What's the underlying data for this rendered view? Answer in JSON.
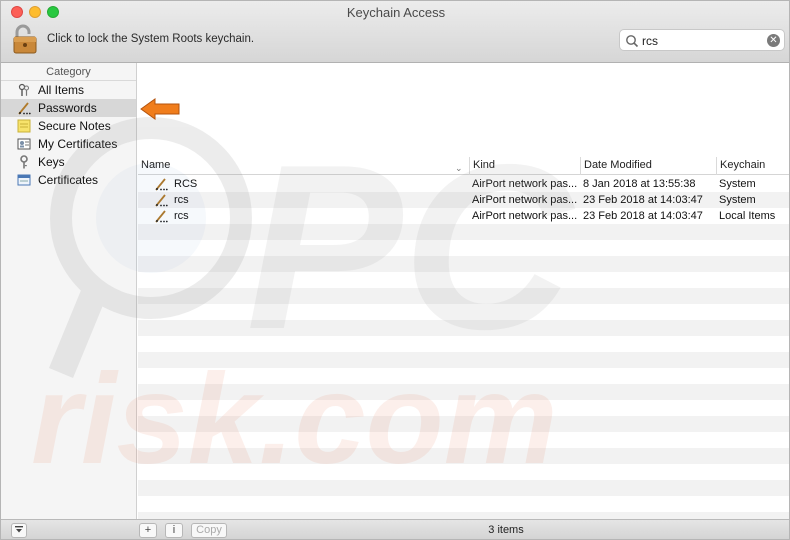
{
  "window": {
    "title": "Keychain Access"
  },
  "toolbar": {
    "lock_text": "Click to lock the System Roots keychain."
  },
  "search": {
    "value": "rcs"
  },
  "sidebar": {
    "header": "Category",
    "items": [
      {
        "label": "All Items",
        "icon": "all-items-icon"
      },
      {
        "label": "Passwords",
        "icon": "password-icon"
      },
      {
        "label": "Secure Notes",
        "icon": "secure-note-icon"
      },
      {
        "label": "My Certificates",
        "icon": "my-certificate-icon"
      },
      {
        "label": "Keys",
        "icon": "key-icon"
      },
      {
        "label": "Certificates",
        "icon": "certificate-icon"
      }
    ]
  },
  "table": {
    "columns": [
      "Name",
      "Kind",
      "Date Modified",
      "Keychain"
    ],
    "rows": [
      {
        "name": "RCS",
        "kind": "AirPort network pas...",
        "date": "8 Jan 2018 at 13:55:38",
        "keychain": "System"
      },
      {
        "name": "rcs",
        "kind": "AirPort network pas...",
        "date": "23 Feb 2018 at 14:03:47",
        "keychain": "System"
      },
      {
        "name": "rcs",
        "kind": "AirPort network pas...",
        "date": "23 Feb 2018 at 14:03:47",
        "keychain": "Local Items"
      }
    ]
  },
  "bottom": {
    "copy_label": "Copy",
    "status": "3 items"
  },
  "watermark": {
    "line1": "PC",
    "line2": "risk.com"
  },
  "colors": {
    "arrow": "#f07d1c",
    "selection": "#d7d7d7"
  }
}
